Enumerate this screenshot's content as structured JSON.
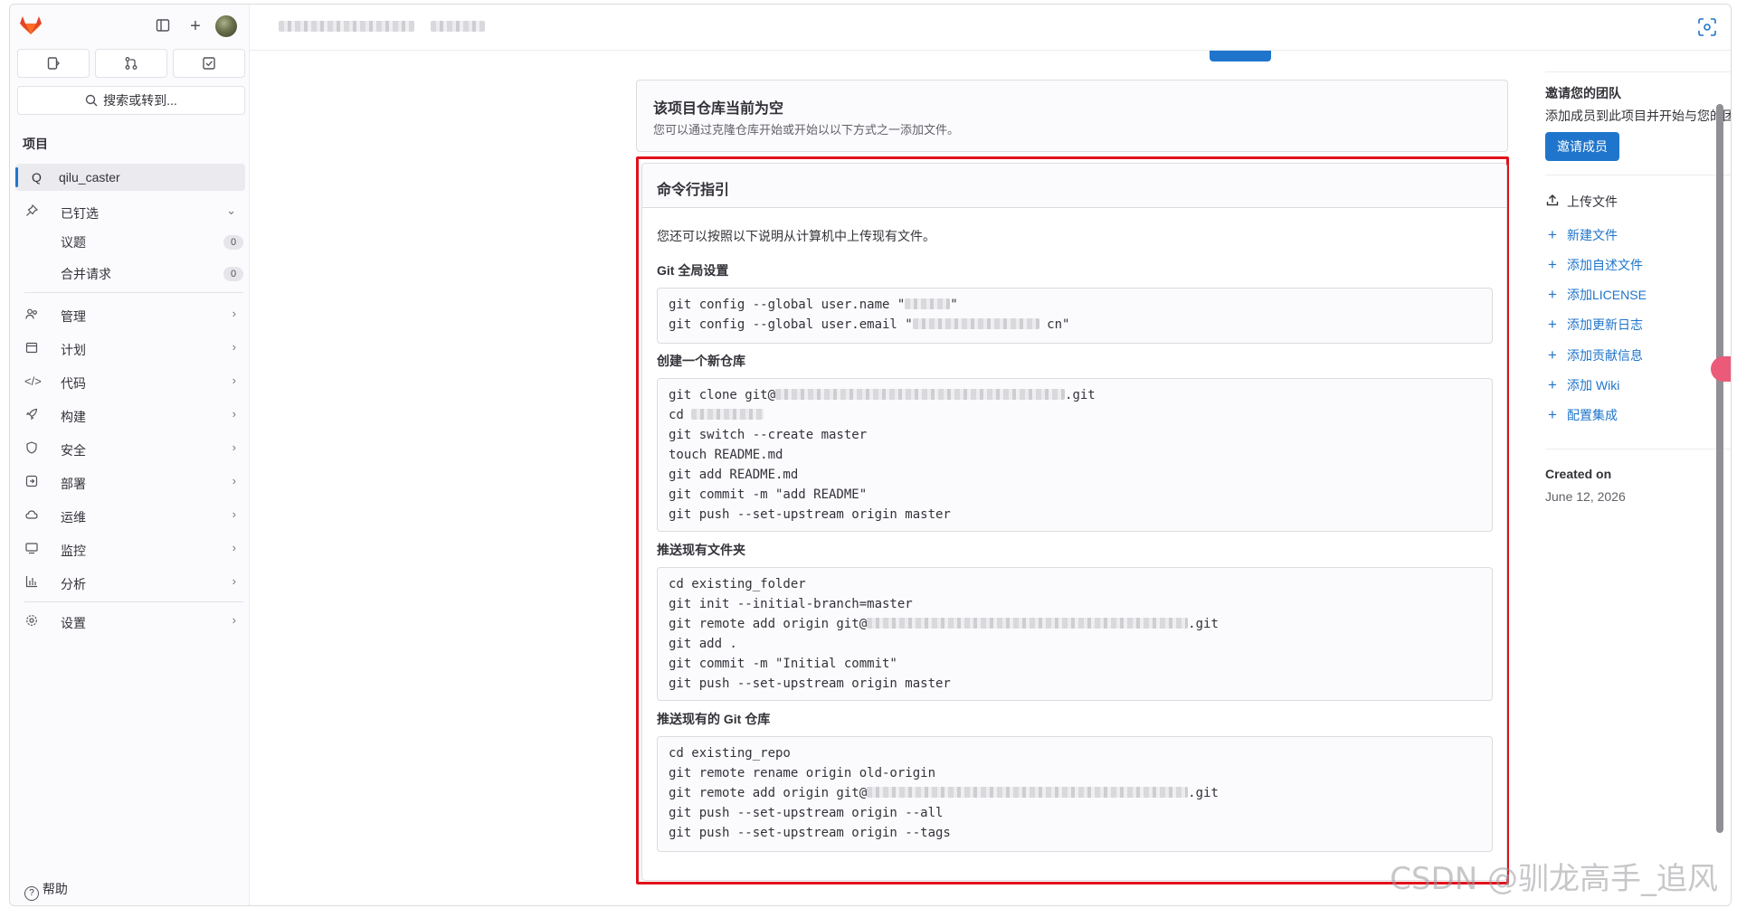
{
  "sidebar": {
    "search_placeholder": "搜索或转到...",
    "section_title": "项目",
    "project": {
      "initial": "Q",
      "name": "qilu_caster"
    },
    "pinned": {
      "label": "已钉选",
      "items": [
        {
          "label": "议题",
          "count": "0"
        },
        {
          "label": "合并请求",
          "count": "0"
        }
      ]
    },
    "nav": [
      {
        "label": "管理",
        "icon": "users-icon"
      },
      {
        "label": "计划",
        "icon": "calendar-icon"
      },
      {
        "label": "代码",
        "icon": "code-icon"
      },
      {
        "label": "构建",
        "icon": "rocket-icon"
      },
      {
        "label": "安全",
        "icon": "shield-icon"
      },
      {
        "label": "部署",
        "icon": "deploy-icon"
      },
      {
        "label": "运维",
        "icon": "cloud-icon"
      },
      {
        "label": "监控",
        "icon": "monitor-icon"
      },
      {
        "label": "分析",
        "icon": "chart-icon"
      }
    ],
    "settings_label": "设置",
    "help_label": "帮助"
  },
  "empty_repo": {
    "title": "该项目仓库当前为空",
    "description": "您可以通过克隆仓库开始或开始以以下方式之一添加文件。"
  },
  "cli": {
    "title": "命令行指引",
    "intro": "您还可以按照以下说明从计算机中上传现有文件。",
    "sections": [
      {
        "heading": "Git 全局设置",
        "lines": [
          "git config --global user.name \"",
          "git config --global user.email \""
        ],
        "tails": [
          "\"",
          "cn\""
        ]
      },
      {
        "heading": "创建一个新仓库",
        "lines": [
          "git clone git@",
          "cd ",
          "git switch --create master",
          "touch README.md",
          "git add README.md",
          "git commit -m \"add README\"",
          "git push --set-upstream origin master"
        ],
        "tails": [
          ".git"
        ]
      },
      {
        "heading": "推送现有文件夹",
        "lines": [
          "cd existing_folder",
          "git init --initial-branch=master",
          "git remote add origin git@",
          "git add .",
          "git commit -m \"Initial commit\"",
          "git push --set-upstream origin master"
        ],
        "tails": [
          ".git"
        ]
      },
      {
        "heading": "推送现有的 Git 仓库",
        "lines": [
          "cd existing_repo",
          "git remote rename origin old-origin",
          "git remote add origin git@",
          "git push --set-upstream origin --all",
          "git push --set-upstream origin --tags"
        ],
        "tails": [
          ".git"
        ]
      }
    ]
  },
  "right": {
    "invite_title": "邀请您的团队",
    "invite_text": "添加成员到此项目并开始与您的团队合作。",
    "invite_button": "邀请成员",
    "upload_label": "上传文件",
    "links": [
      "新建文件",
      "添加自述文件",
      "添加LICENSE",
      "添加更新日志",
      "添加贡献信息",
      "添加 Wiki",
      "配置集成"
    ],
    "created_label": "Created on",
    "created_date": "June 12, 2026"
  },
  "watermark": "CSDN @驯龙高手_追风",
  "colors": {
    "accent": "#1f75cb",
    "highlight": "#e0121b",
    "sidebar_bg": "#fbfafd"
  }
}
